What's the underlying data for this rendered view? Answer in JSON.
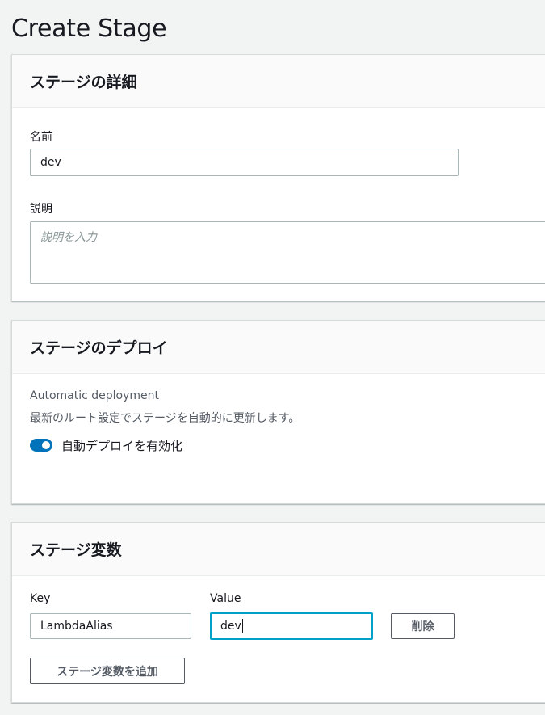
{
  "page": {
    "title": "Create Stage"
  },
  "stage_details": {
    "heading": "ステージの詳細",
    "name_label": "名前",
    "name_value": "dev",
    "description_label": "説明",
    "description_placeholder": "説明を入力"
  },
  "stage_deploy": {
    "heading": "ステージのデプロイ",
    "auto_label": "Automatic deployment",
    "auto_description": "最新のルート設定でステージを自動的に更新します。",
    "toggle_label": "自動デプロイを有効化",
    "toggle_on": true
  },
  "stage_variables": {
    "heading": "ステージ変数",
    "key_label": "Key",
    "value_label": "Value",
    "rows": [
      {
        "key": "LambdaAlias",
        "value": "dev"
      }
    ],
    "delete_label": "削除",
    "add_label": "ステージ変数を追加"
  },
  "colors": {
    "accent": "#0073bb",
    "focus": "#00a1c9"
  }
}
